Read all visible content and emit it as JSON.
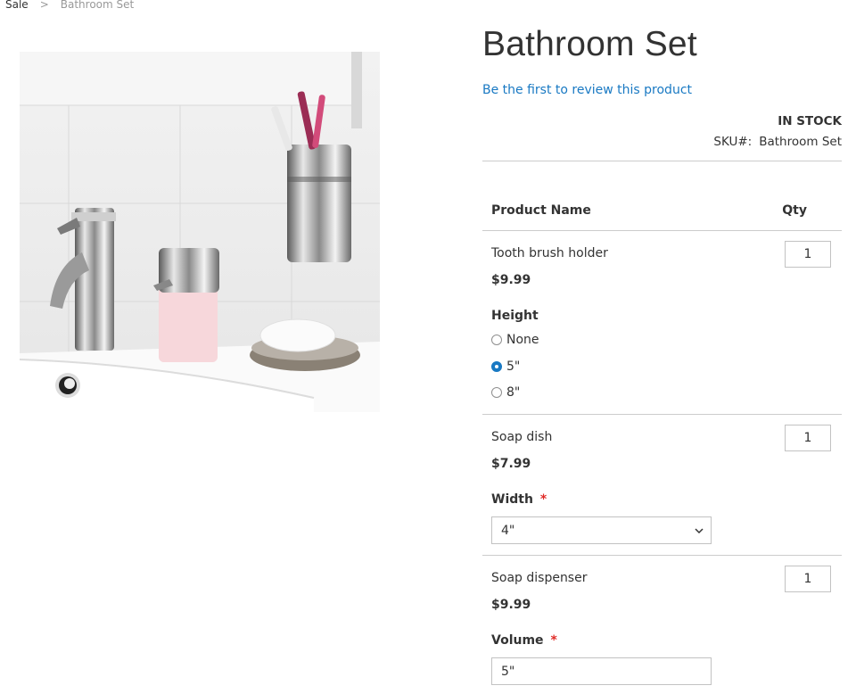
{
  "breadcrumb": {
    "parent": "Sale",
    "separator": ">",
    "current": "Bathroom Set"
  },
  "product": {
    "title": "Bathroom Set",
    "review_link": "Be the first to review this product",
    "stock": "IN STOCK",
    "sku_label": "SKU#:",
    "sku_value": "Bathroom Set"
  },
  "table": {
    "col_name": "Product Name",
    "col_qty": "Qty"
  },
  "items": [
    {
      "name": "Tooth brush holder",
      "price": "$9.99",
      "qty": "1",
      "option_label": "Height",
      "options": [
        "None",
        "5\"",
        "8\""
      ],
      "selected": "5\""
    },
    {
      "name": "Soap dish",
      "price": "$7.99",
      "qty": "1",
      "option_label": "Width",
      "required_mark": "*",
      "select_value": "4\""
    },
    {
      "name": "Soap dispenser",
      "price": "$9.99",
      "qty": "1",
      "option_label": "Volume",
      "required_mark": "*",
      "input_value": "5\""
    }
  ],
  "colors": {
    "link": "#1979c3",
    "required": "#e02b27",
    "text": "#333333"
  }
}
